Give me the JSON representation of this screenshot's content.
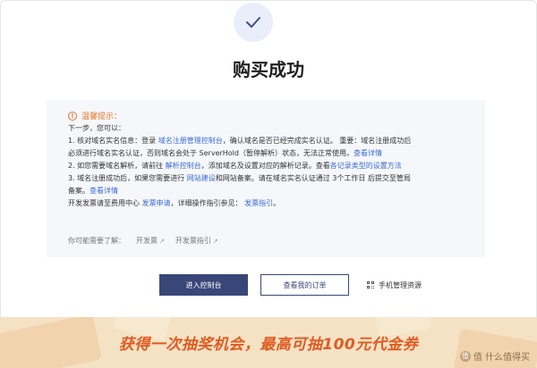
{
  "header": {
    "title": "购买成功"
  },
  "notice": {
    "title": "温馨提示：",
    "intro": "下一步，您可以：",
    "line1_a": "1. 核对域名实名信息：登录 ",
    "line1_link": "域名注册管理控制台",
    "line1_b": "，确认域名是否已经完成实名认证。 重要：域名注册成功后",
    "line2_a": "必须进行域名实名认证，否则域名会处于 ServerHold（暂停解析）状态，无法正常使用。",
    "line2_link": "查看详情",
    "line3_a": "2. 如您需要域名解析，请前往 ",
    "line3_link": "解析控制台",
    "line3_b": "，添加域名及设置对应的解析记录。查看",
    "line3_link2": "各记录类型的设置方法",
    "line4_a": "3. 域名注册成功后，如果您需要进行 ",
    "line4_link": "网站建设",
    "line4_b": "和网站备案。请在域名实名认证通过 3个工作日 后提交至管局",
    "line5_a": "备案。",
    "line5_link": "查看详情",
    "line6_a": "开发发票请至费用中心 ",
    "line6_link": "发票申请",
    "line6_b": "，详细操作指引参见： ",
    "line6_link2": "发票指引",
    "line6_c": "。",
    "maybe_label": "你可能需要了解：",
    "maybe_links": [
      "开发票",
      "开发票指引"
    ]
  },
  "actions": {
    "console": "进入控制台",
    "orders": "查看我的订单",
    "mobile": "手机管理资源"
  },
  "banner": {
    "text": "获得一次抽奖机会，最高可抽100元代金券",
    "watermark": "值 什么值得买"
  },
  "colors": {
    "primary": "#394678",
    "link": "#3a6bd6",
    "warning": "#e6742e",
    "banner_text": "#e05b21"
  }
}
